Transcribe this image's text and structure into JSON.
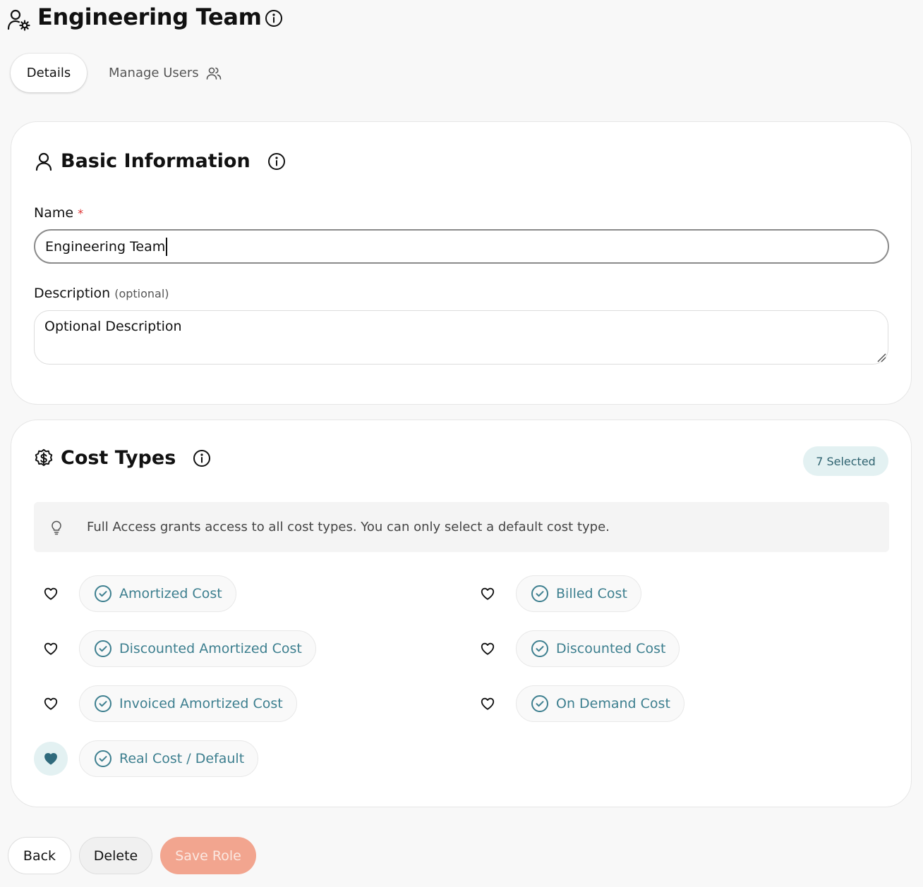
{
  "header": {
    "title": "Engineering Team",
    "icon": "user-settings-icon",
    "info_icon": "info-icon"
  },
  "tabs": [
    {
      "label": "Details",
      "active": true
    },
    {
      "label": "Manage Users",
      "icon": "users-icon",
      "active": false
    }
  ],
  "basic_info": {
    "title": "Basic Information",
    "icon": "user-icon",
    "name_label": "Name",
    "name_required_marker": "*",
    "name_value": "Engineering Team",
    "description_label": "Description",
    "description_optional": "(optional)",
    "description_placeholder": "Optional Description"
  },
  "cost_types": {
    "title": "Cost Types",
    "icon": "dollar-badge-icon",
    "selected_badge": "7 Selected",
    "hint": "Full Access grants access to all cost types. You can only select a default cost type.",
    "hint_icon": "lightbulb-icon",
    "items": [
      {
        "label": "Amortized Cost",
        "checked": true,
        "favorite": false
      },
      {
        "label": "Billed Cost",
        "checked": true,
        "favorite": false
      },
      {
        "label": "Discounted Amortized Cost",
        "checked": true,
        "favorite": false
      },
      {
        "label": "Discounted Cost",
        "checked": true,
        "favorite": false
      },
      {
        "label": "Invoiced Amortized Cost",
        "checked": true,
        "favorite": false
      },
      {
        "label": "On Demand Cost",
        "checked": true,
        "favorite": false
      },
      {
        "label": "Real Cost / Default",
        "checked": true,
        "favorite": true
      }
    ]
  },
  "footer": {
    "back_label": "Back",
    "delete_label": "Delete",
    "save_label": "Save Role"
  },
  "colors": {
    "accent": "#3d7f8f",
    "badge_bg": "#e3f1f2",
    "save_disabled": "#f2a58f",
    "required": "#dd3333"
  }
}
